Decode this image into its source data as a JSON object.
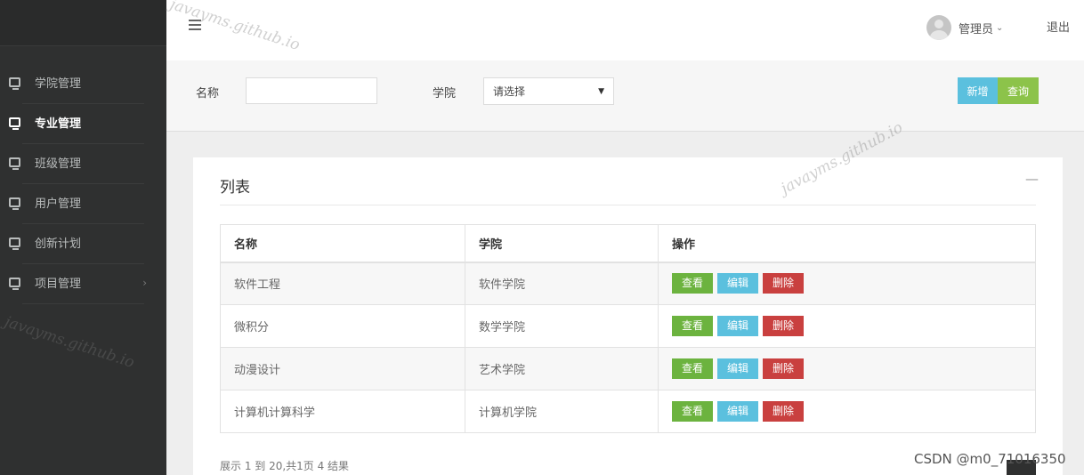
{
  "sidebar": {
    "items": [
      {
        "label": "学院管理",
        "active": false,
        "has_children": false
      },
      {
        "label": "专业管理",
        "active": true,
        "has_children": false
      },
      {
        "label": "班级管理",
        "active": false,
        "has_children": false
      },
      {
        "label": "用户管理",
        "active": false,
        "has_children": false
      },
      {
        "label": "创新计划",
        "active": false,
        "has_children": false
      },
      {
        "label": "项目管理",
        "active": false,
        "has_children": true
      }
    ]
  },
  "header": {
    "user_name": "管理员",
    "logout_label": "退出"
  },
  "search": {
    "name_label": "名称",
    "name_value": "",
    "college_label": "学院",
    "college_selected": "请选择",
    "add_label": "新增",
    "query_label": "查询"
  },
  "card": {
    "title": "列表",
    "collapse_symbol": "—"
  },
  "table": {
    "headers": [
      "名称",
      "学院",
      "操作"
    ],
    "rows": [
      {
        "name": "软件工程",
        "college": "软件学院"
      },
      {
        "name": "微积分",
        "college": "数学学院"
      },
      {
        "name": "动漫设计",
        "college": "艺术学院"
      },
      {
        "name": "计算机计算科学",
        "college": "计算机学院"
      }
    ],
    "actions": {
      "view": "查看",
      "edit": "编辑",
      "delete": "删除"
    }
  },
  "pagination": {
    "info": "展示 1 到 20,共1页 4 结果"
  },
  "watermarks": {
    "text": "javayms.github.io",
    "credit": "CSDN @m0_71016350"
  },
  "colors": {
    "sidebar_bg": "#2f3030",
    "add_button": "#5bc0de",
    "query_button": "#8cc34a",
    "view_button": "#6cb33f",
    "edit_button": "#5bc0de",
    "delete_button": "#c9403f"
  }
}
